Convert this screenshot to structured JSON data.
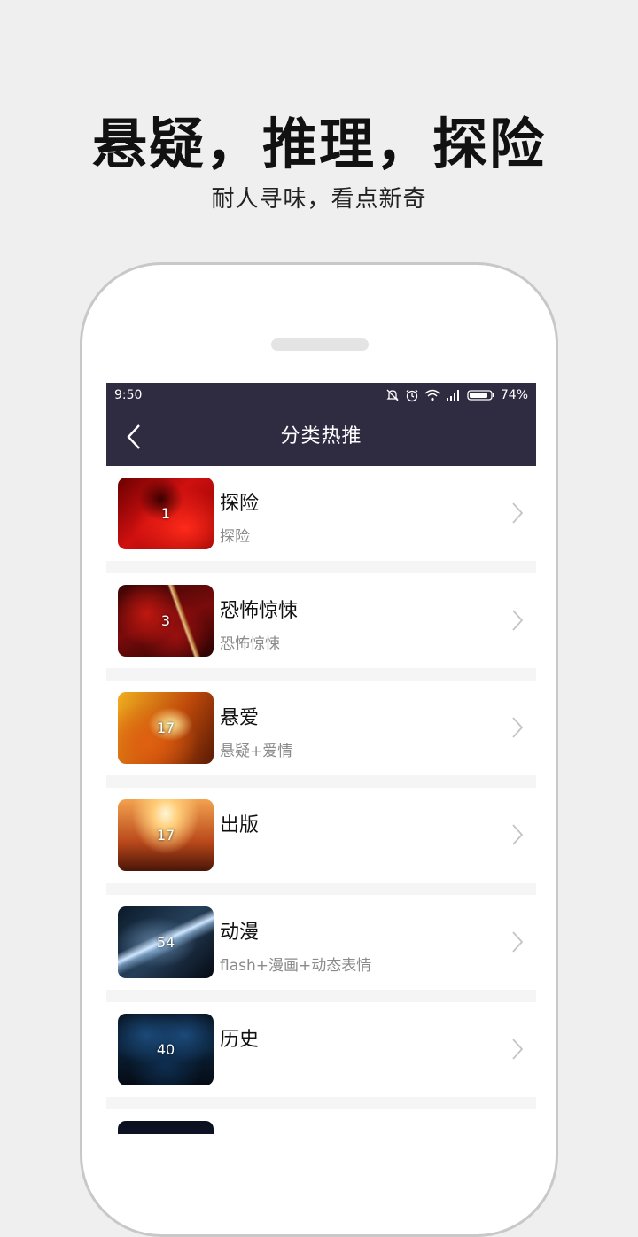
{
  "promo": {
    "headline": "悬疑，推理，探险",
    "subline": "耐人寻味，看点新奇"
  },
  "statusbar": {
    "time": "9:50",
    "battery": "74%",
    "icons": [
      "mute-icon",
      "alarm-icon",
      "wifi-icon",
      "signal-icon",
      "battery-icon"
    ]
  },
  "navbar": {
    "title": "分类热推",
    "back_icon": "chevron-left-icon"
  },
  "categories": [
    {
      "title": "探险",
      "subtitle": "探险",
      "count": "1"
    },
    {
      "title": "恐怖惊悚",
      "subtitle": "恐怖惊悚",
      "count": "3"
    },
    {
      "title": "悬爱",
      "subtitle": "悬疑+爱情",
      "count": "17"
    },
    {
      "title": "出版",
      "subtitle": "",
      "count": "17"
    },
    {
      "title": "动漫",
      "subtitle": "flash+漫画+动态表情",
      "count": "54"
    },
    {
      "title": "历史",
      "subtitle": "",
      "count": "40"
    }
  ],
  "colors": {
    "header_bg": "#2f2c42",
    "page_bg": "#efefef"
  }
}
